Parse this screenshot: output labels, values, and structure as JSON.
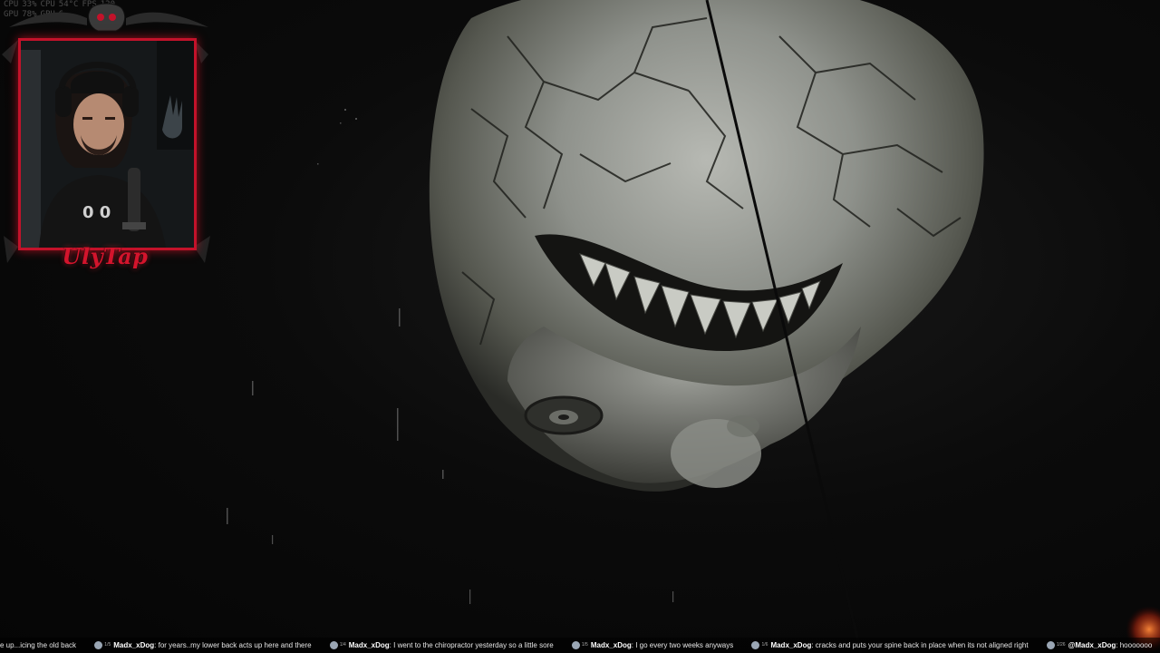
{
  "stats": {
    "row1": [
      "CPU",
      "33%",
      "CPU",
      "54°C",
      "FPS",
      "120"
    ],
    "row2": [
      "GPU",
      "78%",
      "GPU",
      "6"
    ]
  },
  "webcam": {
    "streamer_name": "UlyTap",
    "frame_color": "#c3122a"
  },
  "scene": {
    "subject": "pale-monster-head",
    "tone": "dark-grayscale"
  },
  "chat": {
    "messages": [
      {
        "level": "",
        "user": "",
        "text": "e up...icing the old back"
      },
      {
        "level": "1/5",
        "user": "Madx_xDog",
        "text": "for years..my lower back acts up here and there"
      },
      {
        "level": "1/4",
        "user": "Madx_xDog",
        "text": "I went to the chiropractor yesterday so a little sore"
      },
      {
        "level": "1/5",
        "user": "Madx_xDog",
        "text": "I go every two weeks anyways"
      },
      {
        "level": "1/6",
        "user": "Madx_xDog",
        "text": "cracks and puts your spine back in place when its not aligned right"
      },
      {
        "level": "1/26",
        "user": "@Madx_xDog",
        "text": "hooooooo"
      }
    ]
  }
}
